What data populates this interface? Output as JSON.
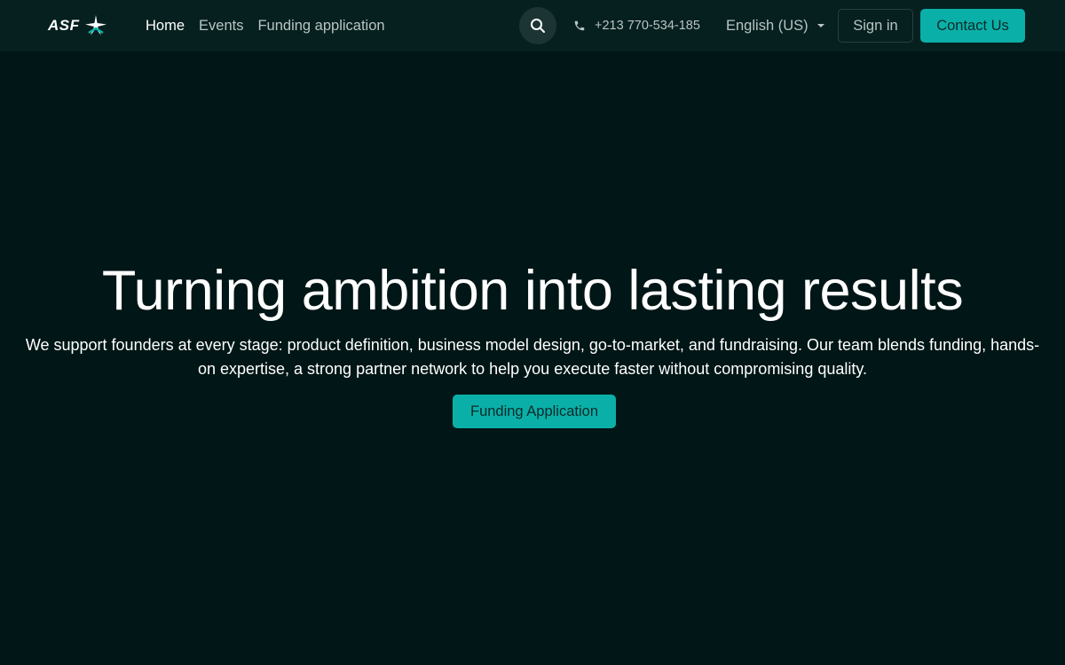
{
  "nav": {
    "logo_text": "ASF",
    "links": [
      {
        "label": "Home",
        "active": true
      },
      {
        "label": "Events",
        "active": false
      },
      {
        "label": "Funding application",
        "active": false
      }
    ],
    "phone": "+213 770-534-185",
    "language": "English (US)",
    "signin_label": "Sign in",
    "contact_label": "Contact Us"
  },
  "hero": {
    "title": "Turning ambition into lasting results",
    "subtitle": "We support founders at every stage: product definition, business model design, go-to-market, and fundraising. Our team blends funding, hands-on expertise, a strong partner network to help you execute faster without compromising quality.",
    "cta_label": "Funding Application"
  },
  "colors": {
    "background": "#011616",
    "navbar": "#05201f",
    "accent": "#0ab0a8",
    "muted_text": "#b9c4c3"
  },
  "icons": {
    "search": "search-icon",
    "phone": "phone-icon",
    "caret": "chevron-down-icon",
    "logo": "asf-star-logo-icon"
  }
}
